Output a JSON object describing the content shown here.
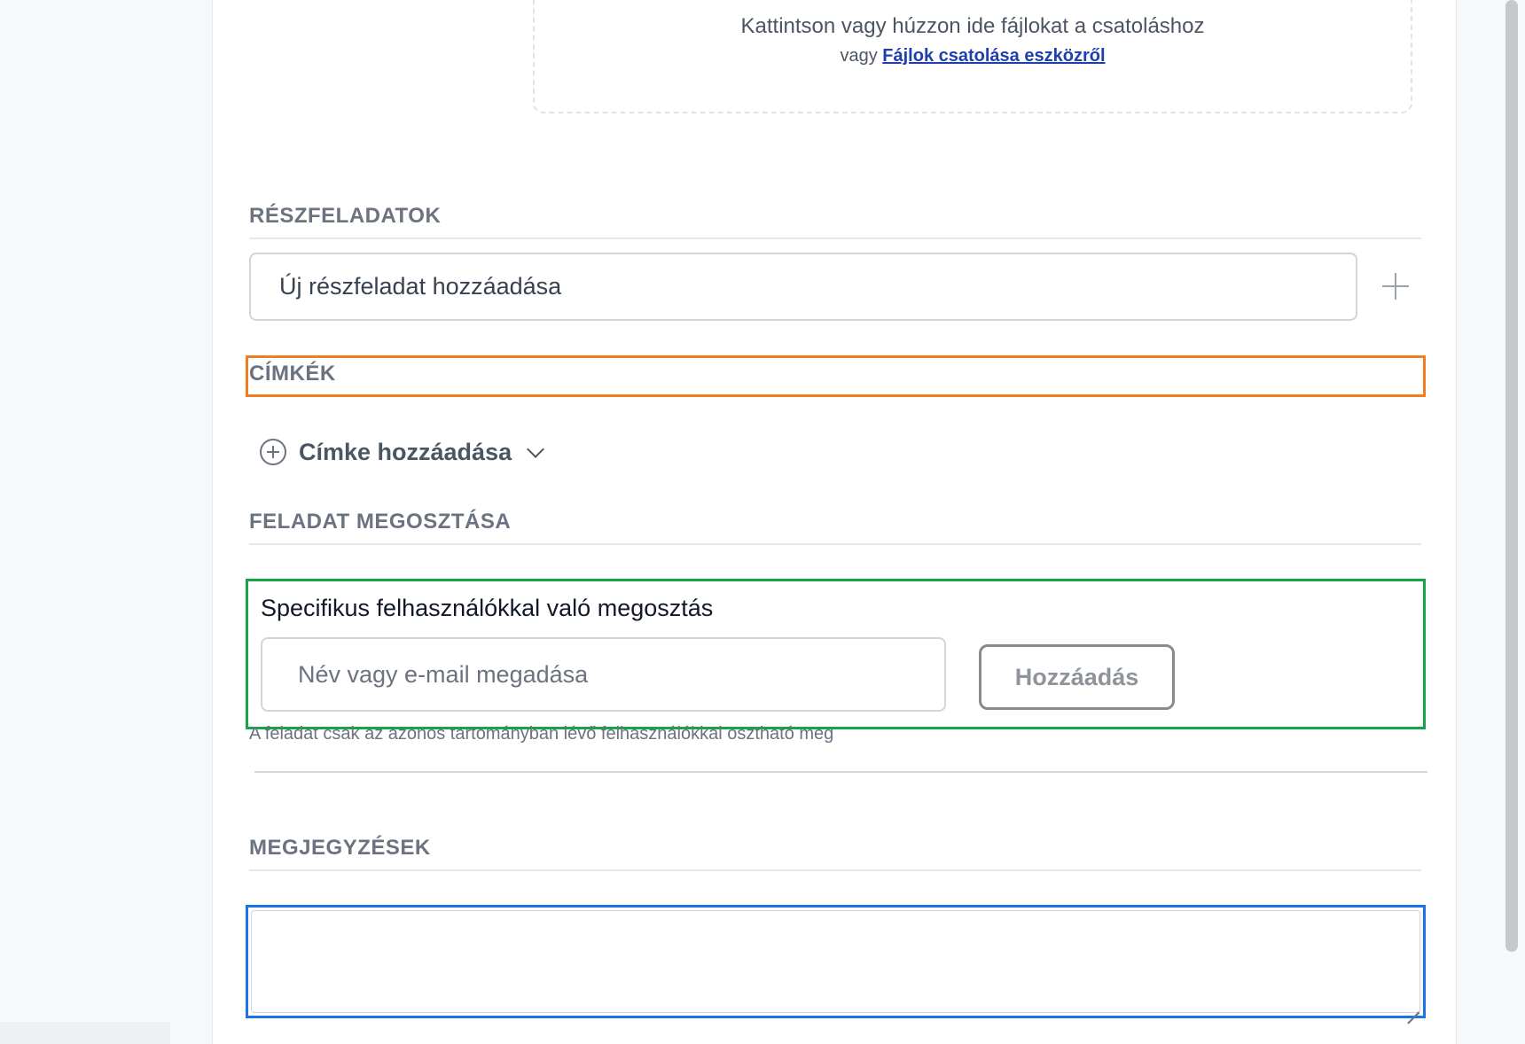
{
  "attachments": {
    "dropzone_text": "Kattintson vagy húzzon ide fájlokat a csatoláshoz",
    "dropzone_prefix": "vagy",
    "dropzone_link": "Fájlok csatolása eszközről"
  },
  "subtasks": {
    "title": "RÉSZFELADATOK",
    "input_placeholder": "Új részfeladat hozzáadása"
  },
  "tags": {
    "title": "CÍMKÉK",
    "add_label": "Címke hozzáadása"
  },
  "sharing": {
    "title": "FELADAT MEGOSZTÁSA",
    "label": "Specifikus felhasználókkal való megosztás",
    "input_placeholder": "Név vagy e-mail megadása",
    "add_button": "Hozzáadás",
    "hint": "A feladat csak az azonos tartományban lévő felhasználókkal osztható meg"
  },
  "notes": {
    "title": "MEGJEGYZÉSEK",
    "value": ""
  },
  "colors": {
    "link": "#1e40af",
    "highlight_orange": "#f47c20",
    "highlight_green": "#16a34a",
    "focus_blue": "#1a73e8"
  }
}
